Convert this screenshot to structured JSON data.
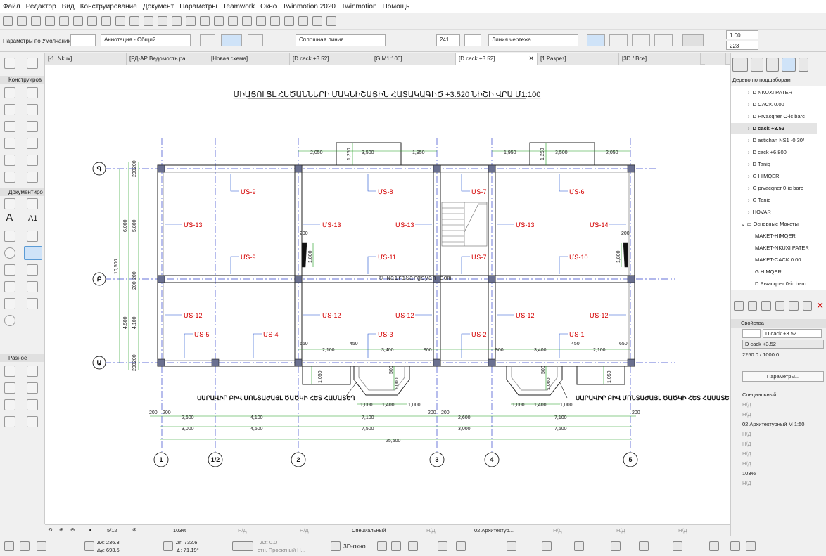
{
  "menu": [
    "Файл",
    "Редактор",
    "Вид",
    "Конструирование",
    "Документ",
    "Параметры",
    "Teamwork",
    "Окно",
    "Twinmotion 2020",
    "Twinmotion",
    "Помощь"
  ],
  "infobox": {
    "default_params": "Параметры по Умолчанию",
    "annotation": "Аннотация - Общий",
    "line_type": "Сплошная линия",
    "pen_number": "241",
    "line_label": "Линия чертежа",
    "scale_a": "1.00",
    "scale_b": "223"
  },
  "tabs": [
    "[-1. Nkux]",
    "[РД-АР Ведомость ра...",
    "[Новая схема]",
    "[D cack +3.52]",
    "[G M1:100]",
    "[D cack +3.52]",
    "[1 Разрез]",
    "[3D / Все]"
  ],
  "toolbox": {
    "construct": "Конструиров",
    "document": "Документиро",
    "misc": "Разное",
    "text_tool": "A",
    "label_tool": "A1"
  },
  "drawing": {
    "title": "ՄԻԱՅՈՒՅԼ ՀԵԾԱՆՆԵՐԻ ՄԱԿՆԻՇԱՅԻՆ ՀԱՏԱԿԱԳԻԾ +3.520 ՆԻՇԻ ՎՐԱ Մ1:100",
    "watermark": "© NairiSargsyan.com",
    "axis_rows": [
      "Գ",
      "Բ",
      "Ա"
    ],
    "axis_cols": [
      "1",
      "1/2",
      "2",
      "3",
      "4",
      "5"
    ],
    "lintels": [
      "ՄՏ-9",
      "ՄՏ-8",
      "ՄՏ-7",
      "ՄՏ-6",
      "ՄՏ-13",
      "ՄՏ-13",
      "ՄՏ-13",
      "ՄՏ-13",
      "ՄՏ-14",
      "ՄՏ-9",
      "ՄՏ-11",
      "ՄՏ-7",
      "ՄՏ-10",
      "ՄՏ-12",
      "ՄՏ-12",
      "ՄՏ-12",
      "ՄՏ-12",
      "ՄՏ-12",
      "ՄՏ-5",
      "ՄՏ-4",
      "ՄՏ-3",
      "ՄՏ-2",
      "ՄՏ-1"
    ],
    "note": "ՍԱՐԱՎԻՐ ԲԻՎ ՄՈՆՏԱԺԱՅԼ ԾԱԾԿԻ ՀԵՏ ՀԱՄԱՏԵՂ",
    "note_right": "ՍԱՐԱՎԻՐ ԲԻՎ ՄՈՆՏԱԺԱՅԼ ԾԱԾԿԻ ՀԵՏ ՀԱՄԱՏԵ",
    "dims_top": [
      "2,050",
      "3,500",
      "1,950",
      "1,950",
      "3,500",
      "2,050",
      "1,250",
      "1,250"
    ],
    "dims_left": [
      "200",
      "200",
      "6,000",
      "5,800",
      "10,500",
      "200",
      "200",
      "4,500",
      "4,100",
      "200",
      "200"
    ],
    "dims_bottom_row1": [
      "200",
      "200",
      "2,600",
      "4,100",
      "7,100",
      "200",
      "200",
      "2,600",
      "7,100",
      "200"
    ],
    "dims_bottom_row2": [
      "3,000",
      "4,500",
      "7,500",
      "3,000",
      "7,500"
    ],
    "dims_total": "25,500",
    "dims_lower": [
      "650",
      "2,100",
      "450",
      "3,400",
      "900",
      "900",
      "3,400",
      "450",
      "2,100",
      "650"
    ],
    "dims_bay": [
      "1,000",
      "1,400",
      "1,000",
      "1,000",
      "1,400",
      "1,000",
      "500",
      "500",
      "1,000",
      "1,000",
      "1,050",
      "1,050"
    ],
    "dims_side": [
      "200",
      "1,800",
      "1,800",
      "200"
    ]
  },
  "navigator": {
    "header": "Дерево по подшаборам",
    "items": [
      "D NKUXI PATER",
      "D CACK 0.00",
      "D Prvacqner O-ic barc",
      "D cack +3.52",
      "D astichan NS1 -0,30/",
      "D cack +6,800",
      "D Taniq",
      "G HIMQER",
      "G prvacqner 0-ic barc",
      "G Taniq",
      "HOVAR",
      "Основные Макеты",
      "MAKET-HIMQER",
      "MAKET-NKUXI PATER",
      "MAKET-CACK 0.00",
      "G HIMQER",
      "D Prvacqner 0-ic barc"
    ]
  },
  "properties": {
    "header": "Свойства",
    "id": "D cack +3.52",
    "name": "D cack +3.52",
    "scale": "2250.0 / 1000.0",
    "button": "Параметры...",
    "special": "Специальный",
    "nd": "Н/Д",
    "arch": "02 Архитектурный М 1:50",
    "zoom": "103%"
  },
  "bottom": {
    "page": "5/12",
    "zoom": "103%",
    "nd": "Н/Д",
    "special": "Специальный",
    "arch": "02 Архитектур...",
    "nd2": "Н/Д"
  },
  "coords": {
    "dx": "Δx: 236.3",
    "dy": "Δy: 693.5",
    "da": "Δr: 732.6",
    "angle": "∡: 71.19°",
    "dz": "Δz: 0.0",
    "ref": "отн. Проектный Н...",
    "view3d": "3D-окно"
  },
  "colors": {
    "axis": "#3344cc",
    "dim": "#1a9b1a",
    "lintel": "#d40000",
    "column": "#6a7090"
  }
}
